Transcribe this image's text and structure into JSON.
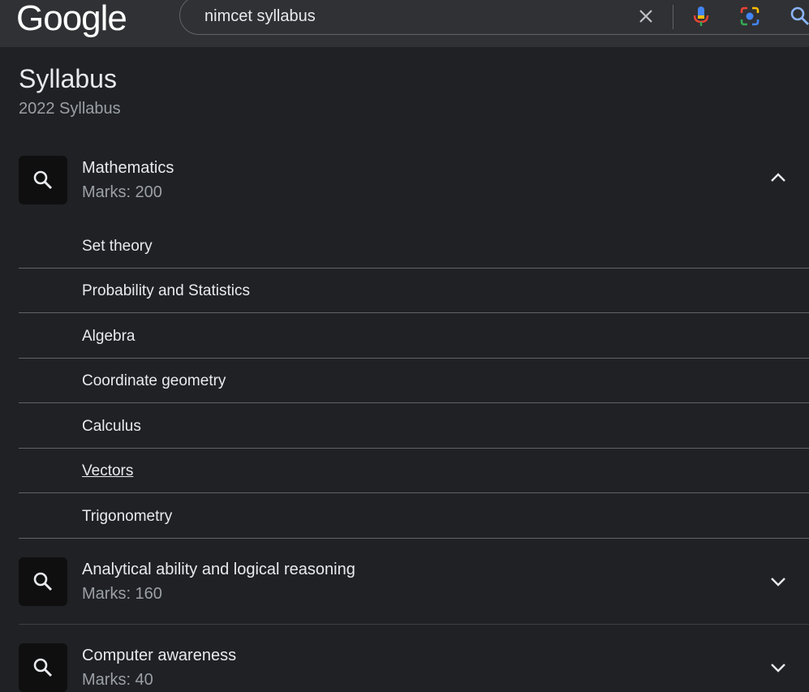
{
  "header": {
    "logo": "Google",
    "query": "nimcet syllabus"
  },
  "panel": {
    "title": "Syllabus",
    "subtitle": "2022 Syllabus"
  },
  "sections": [
    {
      "name": "Mathematics",
      "marks": "Marks: 200",
      "expanded": true,
      "topics": [
        "Set theory",
        "Probability and Statistics",
        "Algebra",
        "Coordinate geometry",
        "Calculus",
        "Vectors",
        "Trigonometry"
      ]
    },
    {
      "name": "Analytical ability and logical reasoning",
      "marks": "Marks: 160",
      "expanded": false
    },
    {
      "name": "Computer awareness",
      "marks": "Marks: 40",
      "expanded": false
    }
  ],
  "colors": {
    "background": "#202124",
    "header": "#303134",
    "text": "#e8eaed",
    "muted": "#9aa0a6"
  }
}
